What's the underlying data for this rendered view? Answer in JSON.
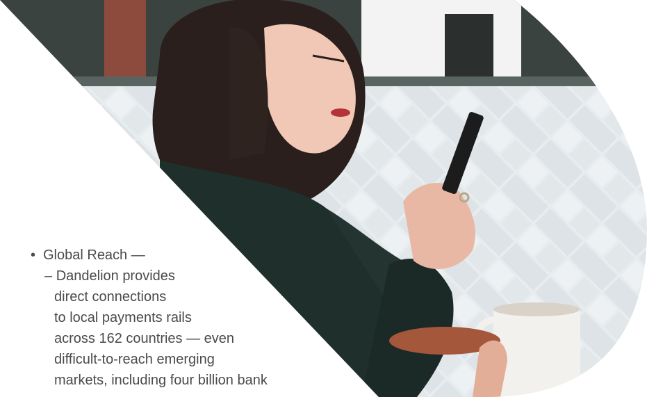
{
  "bullets": [
    {
      "marker": "•",
      "heading": "Global Reach —",
      "sub_marker": "–",
      "lines": [
        "Dandelion provides",
        "direct connections",
        "to local payments rails",
        "across 162 countries — even",
        "difficult-to-reach emerging",
        "markets, including four billion bank"
      ]
    }
  ],
  "photo": {
    "subject": "woman-using-smartphone-with-coffee-cup-icon"
  },
  "colors": {
    "text": "#4a4a4a",
    "background": "#ffffff",
    "tile": "#e6ebee",
    "sweater": "#1f2f2c",
    "hair": "#2a1f1c"
  }
}
